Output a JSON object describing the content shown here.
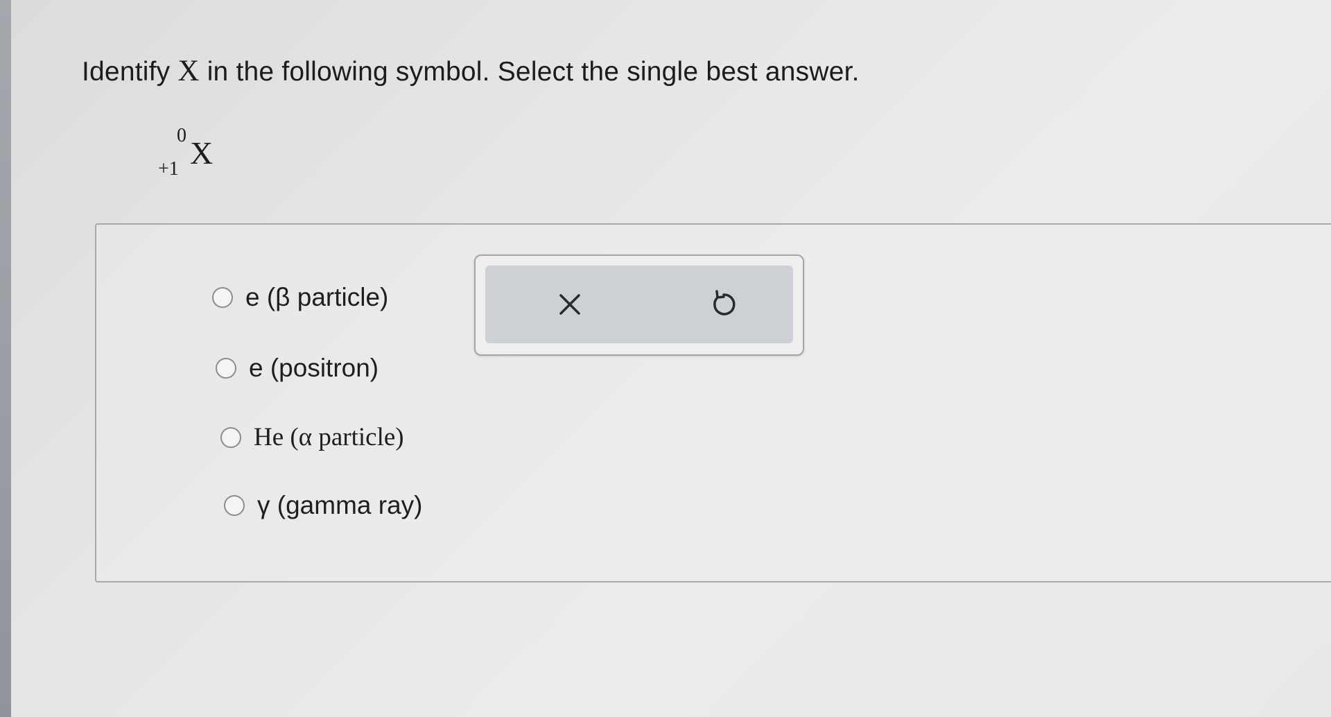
{
  "question": {
    "prefix": "Identify ",
    "variable": "X",
    "suffix": " in the following symbol. Select the single best answer."
  },
  "symbol": {
    "mass_number": "0",
    "charge": "+1",
    "letter": "X"
  },
  "options": [
    {
      "label": "e (β particle)"
    },
    {
      "label": "e (positron)"
    },
    {
      "label": "He (α particle)"
    },
    {
      "label": "γ (gamma ray)"
    }
  ],
  "toolbar": {
    "clear_icon": "close-icon",
    "undo_icon": "undo-icon"
  },
  "colors": {
    "text": "#1c1c1c",
    "toolbar_bg": "#cdd1d5",
    "page_bg": "#e6e6e6"
  }
}
